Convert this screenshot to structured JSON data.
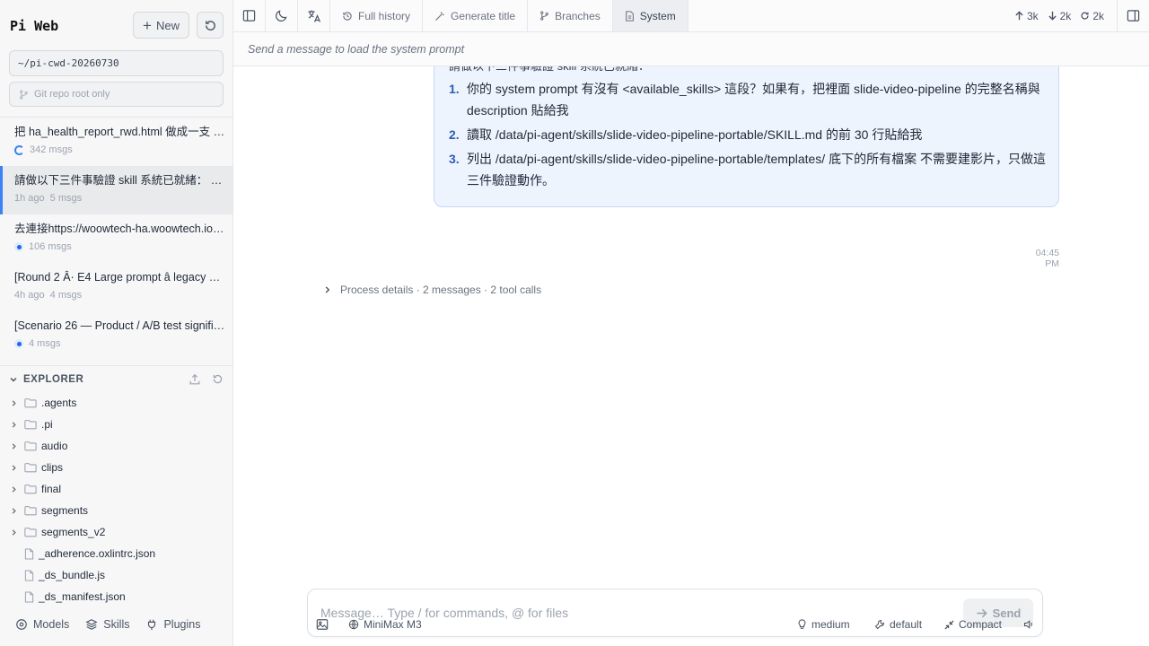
{
  "sidebar": {
    "brand": "Pi Web",
    "new_label": "New",
    "cwd": "~/pi-cwd-20260730",
    "repo_placeholder": "Git repo root only",
    "sessions": [
      {
        "title": "把 ha_health_report_rwd.html 做成一支 3…",
        "time": "",
        "count": "342 msgs",
        "status": "running"
      },
      {
        "title": "請做以下三件事驗證 skill 系統已就緒： 1. …",
        "time": "1h ago",
        "count": "5 msgs",
        "status": "active"
      },
      {
        "title": "去連接https://woowtech-ha.woowtech.io/ …",
        "time": "",
        "count": "106 msgs",
        "status": "live"
      },
      {
        "title": "[Round 2 Â· E4 Large prompt â legacy sc…",
        "time": "4h ago",
        "count": "4 msgs",
        "status": "idle"
      },
      {
        "title": "[Scenario 26 — Product / A/B test significan…",
        "time": "",
        "count": "4 msgs",
        "status": "live"
      }
    ],
    "explorer_label": "EXPLORER",
    "tree": [
      {
        "name": ".agents",
        "type": "folder"
      },
      {
        "name": ".pi",
        "type": "folder"
      },
      {
        "name": "audio",
        "type": "folder"
      },
      {
        "name": "clips",
        "type": "folder"
      },
      {
        "name": "final",
        "type": "folder"
      },
      {
        "name": "segments",
        "type": "folder"
      },
      {
        "name": "segments_v2",
        "type": "folder"
      },
      {
        "name": "_adherence.oxlintrc.json",
        "type": "file"
      },
      {
        "name": "_ds_bundle.js",
        "type": "file"
      },
      {
        "name": "_ds_manifest.json",
        "type": "file"
      }
    ],
    "footer": {
      "models": "Models",
      "skills": "Skills",
      "plugins": "Plugins"
    }
  },
  "topbar": {
    "tabs": {
      "history": "Full history",
      "title": "Generate title",
      "branches": "Branches",
      "system": "System"
    },
    "stats": {
      "up": "3k",
      "down": "2k",
      "cache": "2k"
    }
  },
  "system_notice": "Send a message to load the system prompt",
  "message": {
    "clipped_text": "請做以下三件事驗證 skill 系統已就緒：",
    "items": [
      {
        "num": "1.",
        "text": "你的 system prompt 有沒有 <available_skills> 這段？如果有，把裡面 slide-video-pipeline 的完整名稱與 description 貼給我"
      },
      {
        "num": "2.",
        "text": "讀取 /data/pi-agent/skills/slide-video-pipeline-portable/SKILL.md 的前 30 行貼給我"
      },
      {
        "num": "3.",
        "text": "列出 /data/pi-agent/skills/slide-video-pipeline-portable/templates/ 底下的所有檔案 不需要建影片，只做這三件驗證動作。"
      }
    ],
    "time": "04:45 PM"
  },
  "process_details": "Process details · 2 messages · 2 tool calls",
  "composer": {
    "placeholder": "Message… Type / for commands, @ for files",
    "send": "Send"
  },
  "bottombar": {
    "model": "MiniMax M3",
    "thinking": "medium",
    "tools": "default",
    "compact": "Compact"
  },
  "colors": {
    "accent": "#3b82f6",
    "bubble_bg": "#eef4fe",
    "bubble_border": "#c7d9f5",
    "list_number": "#2b5cb8"
  }
}
